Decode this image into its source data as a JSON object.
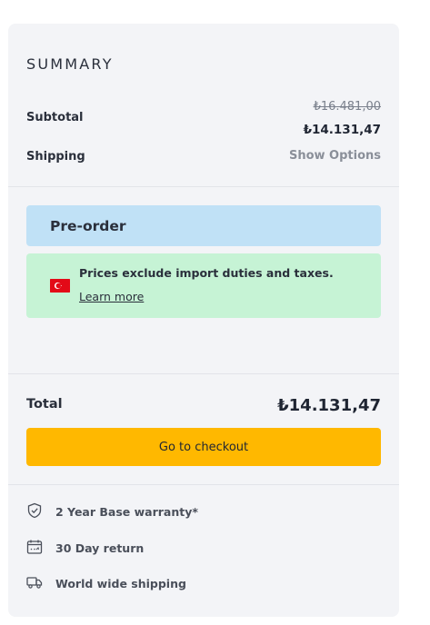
{
  "summary": {
    "title": "SUMMARY",
    "subtotal_label": "Subtotal",
    "subtotal_original": "₺16.481,00",
    "subtotal_price": "₺14.131,47",
    "shipping_label": "Shipping",
    "shipping_action": "Show Options"
  },
  "preorder": {
    "label": "Pre-order"
  },
  "notice": {
    "text": "Prices exclude import duties and taxes.",
    "link": "Learn more",
    "flag_icon": "turkey-flag-icon"
  },
  "total": {
    "label": "Total",
    "value": "₺14.131,47",
    "checkout_label": "Go to checkout"
  },
  "benefits": [
    {
      "icon": "shield-check-icon",
      "label": "2 Year Base warranty*"
    },
    {
      "icon": "calendar-return-icon",
      "label": "30 Day return"
    },
    {
      "icon": "truck-icon",
      "label": "World wide shipping"
    }
  ],
  "colors": {
    "card_bg": "#f3f4f7",
    "preorder_bg": "#c0e1f6",
    "notice_bg": "#c6f3d5",
    "checkout_bg": "#ffb800",
    "flag_red": "#e30a17"
  }
}
